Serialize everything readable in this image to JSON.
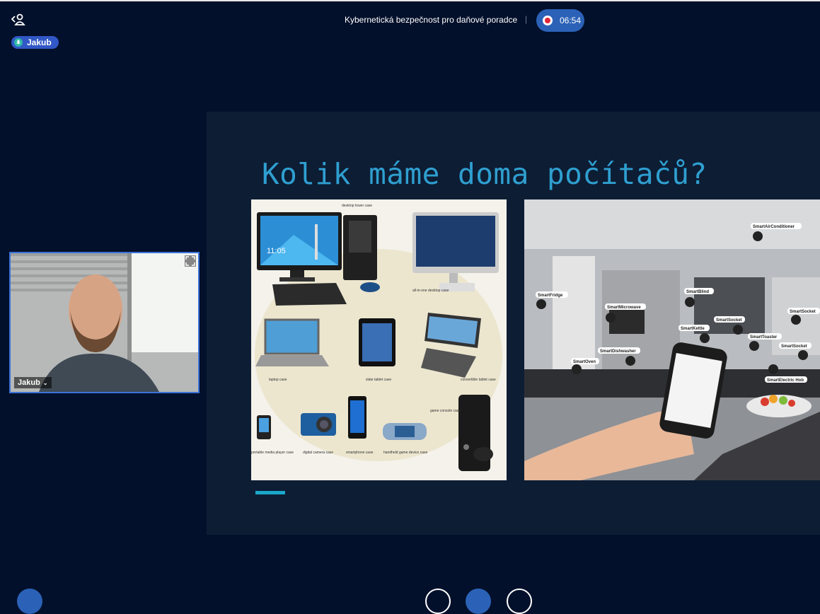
{
  "header": {
    "meeting_title": "Kybernetická bezpečnost pro daňové poradce",
    "separator": "|",
    "recording_time": "06:54"
  },
  "user_chip": {
    "name": "Jakub"
  },
  "camera": {
    "name": "Jakub"
  },
  "slide": {
    "title": "Kolik máme doma počítačů?",
    "progress": 0.05,
    "left_image_labels": [
      "desktop tower case",
      "all-in-one desktop case",
      "laptop case",
      "slate tablet case",
      "convertible tablet case",
      "game console case",
      "portable media player case",
      "digital camera case",
      "smartphone case",
      "handheld game device case"
    ],
    "desktop_clock": "11:05",
    "right_image_labels": [
      "SmartAirConditioner",
      "SmartFridge",
      "SmartBlind",
      "SmartMicrowave",
      "SmartSocket",
      "SmartKettle",
      "SmartSocket",
      "SmartToaster",
      "SmartSocket",
      "SmartDishwasher",
      "SmartOven",
      "SmartElectric Hob"
    ]
  },
  "colors": {
    "background": "#03102b",
    "slide_background": "#0d1d34",
    "title": "#2f9fd0",
    "accent": "#3158c6",
    "record": "#e2263a"
  },
  "icons": {
    "back": "back-person-icon",
    "mic": "mic-icon",
    "record": "record-icon",
    "expand": "expand-icon"
  }
}
